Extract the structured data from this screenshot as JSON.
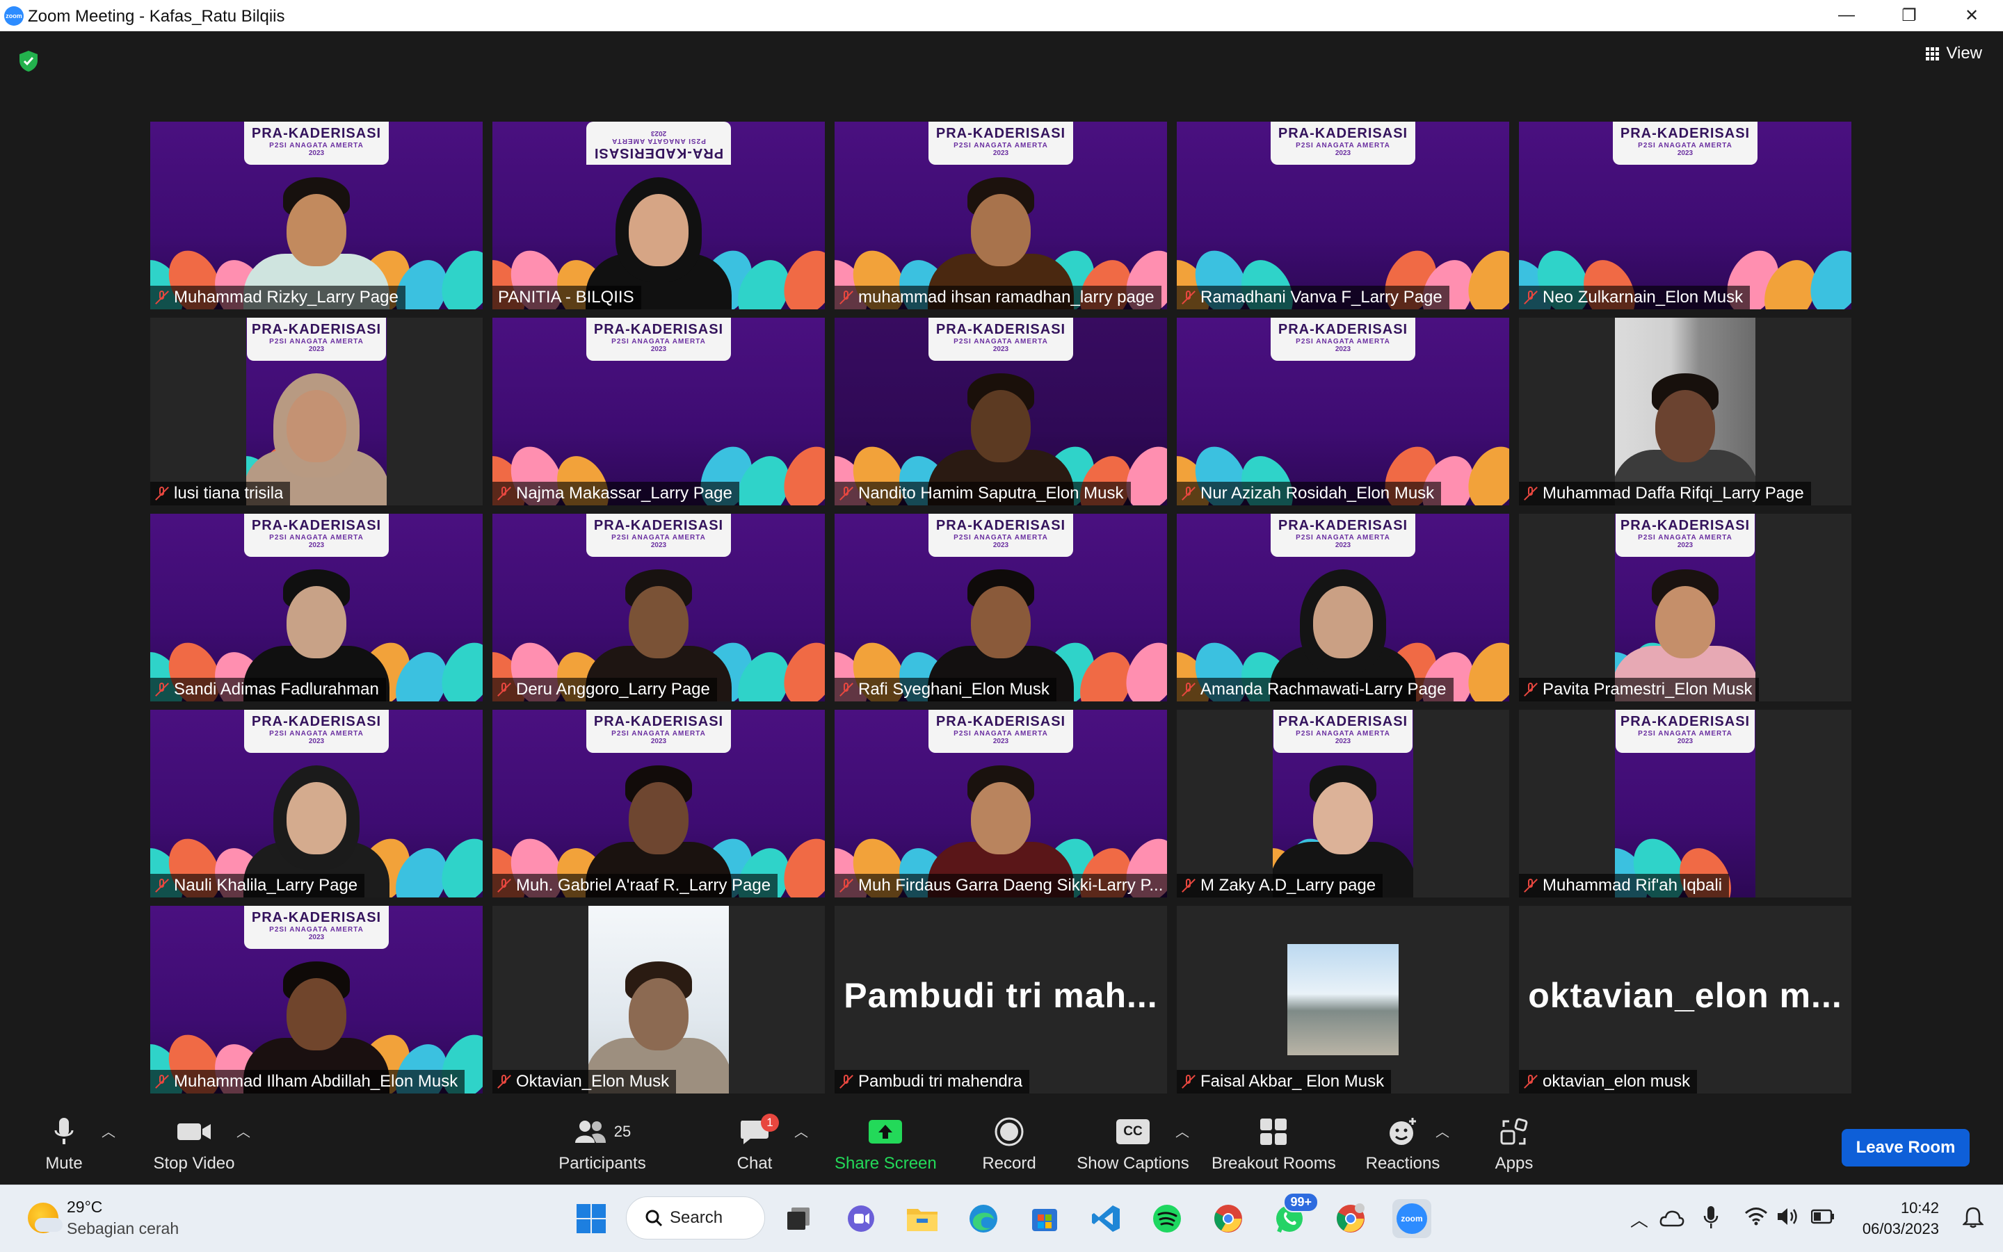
{
  "window": {
    "title": "Zoom Meeting - Kafas_Ratu Bilqiis",
    "app_icon_text": "zoom",
    "controls": [
      "—",
      "❐",
      "✕"
    ]
  },
  "meeting": {
    "view_label": "View",
    "banner": {
      "line1": "PRA-KADERISASI",
      "line2": "P2SI ANAGATA AMERTA",
      "line3": "2023"
    },
    "participants": [
      {
        "name": "Muhammad Rizky_Larry Page",
        "muted": true,
        "bg": "purple",
        "skin": "#c28a5e",
        "shirt": "#cfe4df",
        "hair": "#17110e"
      },
      {
        "name": "PANITIA - BILQIIS",
        "muted": false,
        "bg": "purple",
        "active": true,
        "flip": true,
        "skin": "#d6a585",
        "shirt": "#111",
        "hair": "#111",
        "hijab": true
      },
      {
        "name": "muhammad ihsan ramadhan_larry page",
        "muted": true,
        "bg": "purple",
        "skin": "#a8734c",
        "shirt": "#4a2810",
        "hair": "#1c120d"
      },
      {
        "name": "Ramadhani Vanva F_Larry Page",
        "muted": true,
        "bg": "purple"
      },
      {
        "name": "Neo Zulkarnain_Elon Musk",
        "muted": true,
        "bg": "purple"
      },
      {
        "name": "lusi tiana trisila",
        "muted": true,
        "bg": "purple-narrow",
        "skin": "#c49273",
        "shirt": "#b69a84",
        "hair": "#b89a82",
        "hijab": true
      },
      {
        "name": "Najma Makassar_Larry Page",
        "muted": true,
        "bg": "purple"
      },
      {
        "name": "Nandito Hamim Saputra_Elon Musk",
        "muted": true,
        "bg": "purple-dim",
        "skin": "#5c3a22",
        "shirt": "#2a1a12",
        "hair": "#1a100a"
      },
      {
        "name": "Nur Azizah Rosidah_Elon Musk",
        "muted": true,
        "bg": "purple"
      },
      {
        "name": "Muhammad Daffa Rifqi_Larry Page",
        "muted": true,
        "bg": "photo-strip",
        "skin": "#6b4330",
        "shirt": "#3b3b3b",
        "hair": "#17100c"
      },
      {
        "name": "Sandi Adimas Fadlurahman",
        "muted": true,
        "bg": "purple",
        "skin": "#c8a287",
        "shirt": "#101010",
        "hair": "#101010"
      },
      {
        "name": "Deru Anggoro_Larry Page",
        "muted": true,
        "bg": "purple",
        "skin": "#7a5236",
        "shirt": "#1e1512",
        "hair": "#181210"
      },
      {
        "name": "Rafi Syeghani_Elon Musk",
        "muted": true,
        "bg": "purple",
        "skin": "#8a5a3a",
        "shirt": "#131010",
        "hair": "#0f0b0a"
      },
      {
        "name": "Amanda Rachmawati-Larry Page",
        "muted": true,
        "bg": "purple",
        "skin": "#caa084",
        "shirt": "#141414",
        "hair": "#141414",
        "hijab": true
      },
      {
        "name": "Pavita Pramestri_Elon Musk",
        "muted": true,
        "bg": "purple-narrow",
        "skin": "#c58f6a",
        "shirt": "#e7a9b4",
        "hair": "#1a1210"
      },
      {
        "name": "Nauli Khalila_Larry Page",
        "muted": true,
        "bg": "purple",
        "skin": "#d4ab8e",
        "shirt": "#1c1c1c",
        "hair": "#1b1b1b",
        "hijab": true
      },
      {
        "name": "Muh. Gabriel A'raaf R._Larry Page",
        "muted": true,
        "bg": "purple",
        "skin": "#6e4630",
        "shirt": "#1a120f",
        "hair": "#120c0a"
      },
      {
        "name": "Muh Firdaus Garra Daeng Sikki-Larry P...",
        "muted": true,
        "bg": "purple",
        "skin": "#b9845e",
        "shirt": "#5a1618",
        "hair": "#1a120e"
      },
      {
        "name": "M Zaky A.D_Larry page",
        "muted": true,
        "bg": "purple-narrow",
        "skin": "#dcb298",
        "shirt": "#141414",
        "hair": "#141414"
      },
      {
        "name": "Muhammad Rif'ah Iqbali",
        "muted": true,
        "bg": "purple-narrow"
      },
      {
        "name": "Muhammad Ilham Abdillah_Elon Musk",
        "muted": true,
        "bg": "purple",
        "skin": "#70452c",
        "shirt": "#1a1010",
        "hair": "#0f0a08"
      },
      {
        "name": "Oktavian_Elon Musk",
        "muted": true,
        "bg": "light-strip",
        "skin": "#8c6a52",
        "shirt": "#9d8f7f",
        "hair": "#2a1b12"
      },
      {
        "name": "Pambudi tri mahendra",
        "muted": true,
        "bg": "none",
        "big": "Pambudi tri mah..."
      },
      {
        "name": "Faisal Akbar_ Elon Musk",
        "muted": true,
        "bg": "avatar"
      },
      {
        "name": "oktavian_elon musk",
        "muted": true,
        "bg": "none",
        "big": "oktavian_elon m..."
      }
    ]
  },
  "toolbar": {
    "mute": "Mute",
    "stop_video": "Stop Video",
    "participants": "Participants",
    "participants_count": "25",
    "chat": "Chat",
    "chat_badge": "1",
    "share_screen": "Share Screen",
    "record": "Record",
    "show_captions": "Show Captions",
    "captions_icon": "CC",
    "breakout_rooms": "Breakout Rooms",
    "reactions": "Reactions",
    "apps": "Apps",
    "leave": "Leave Room",
    "share_color": "#23d959"
  },
  "taskbar": {
    "weather_temp": "29°C",
    "weather_desc": "Sebagian cerah",
    "search": "Search",
    "whatsapp_badge": "99+",
    "zoom_label": "zoom",
    "time": "10:42",
    "date": "06/03/2023"
  }
}
